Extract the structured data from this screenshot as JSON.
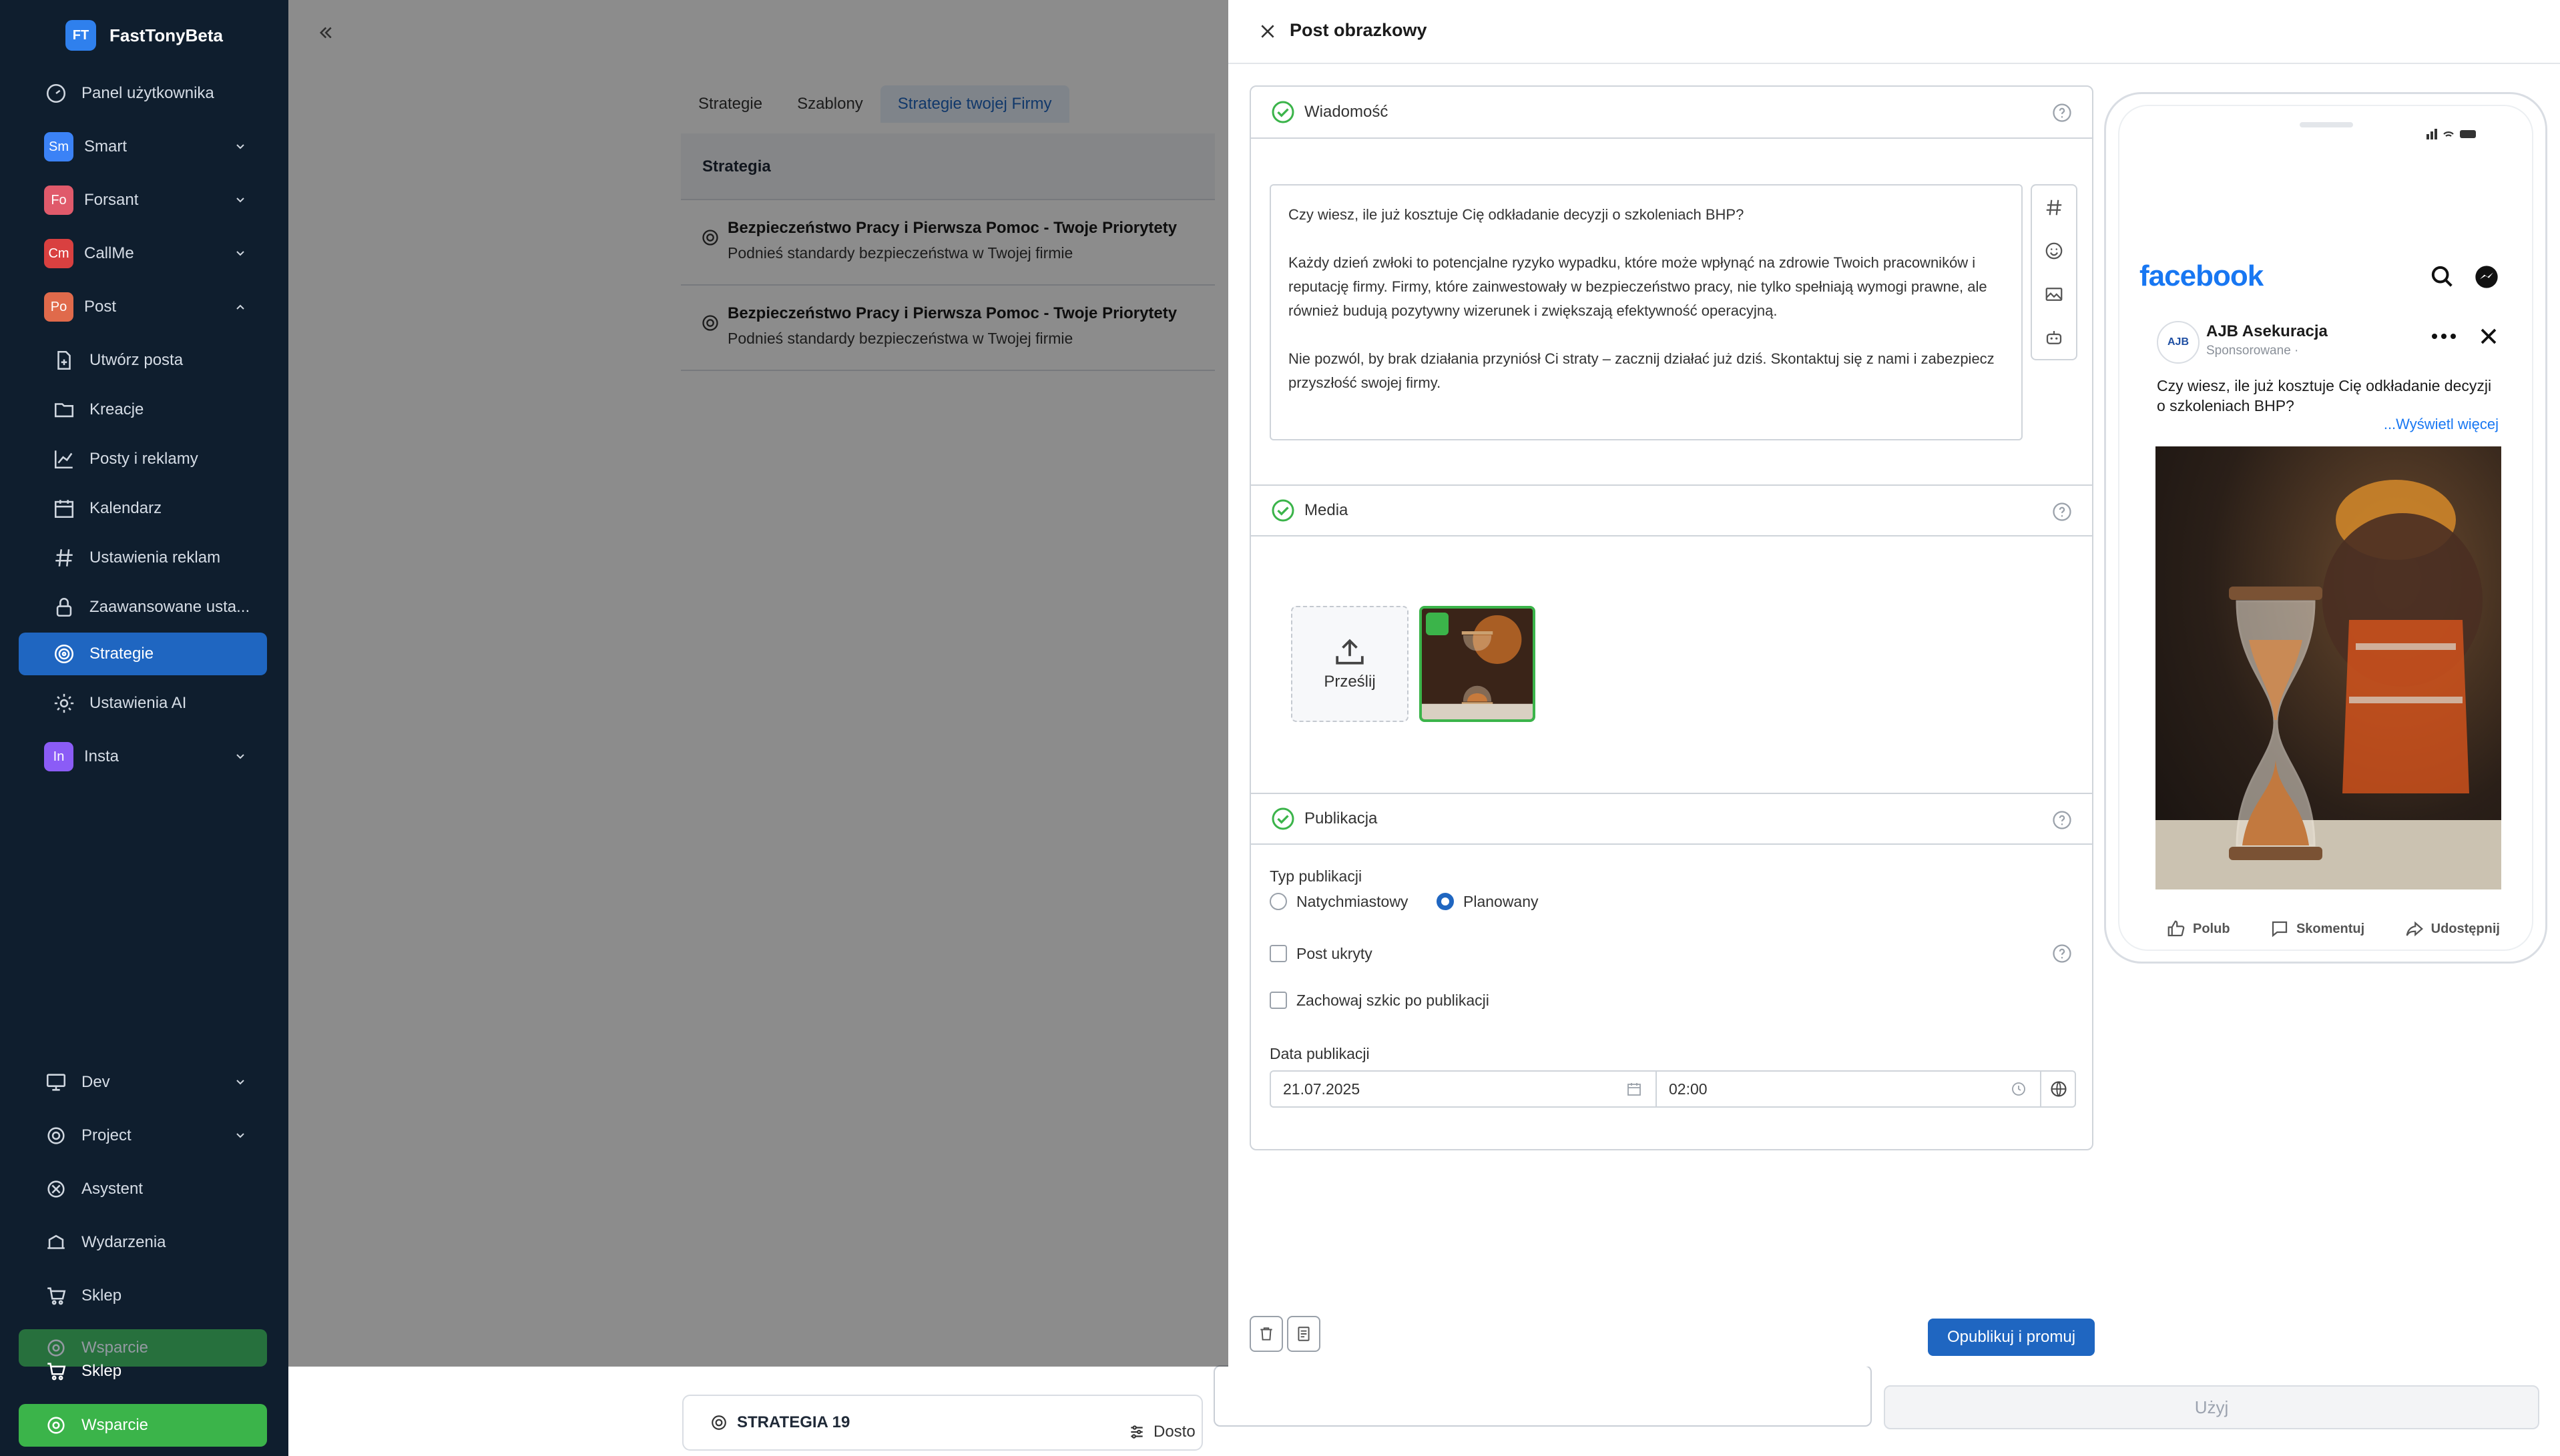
{
  "sidebar": {
    "brand": {
      "logo": "FT",
      "name": "FastTonyBeta"
    },
    "items": [
      {
        "label": "Panel użytkownika",
        "icon": "dashboard-icon"
      },
      {
        "label": "Smart",
        "badge": "Sm",
        "badge_color": "#3b82f6",
        "expandable": true
      },
      {
        "label": "Forsant",
        "badge": "Fo",
        "badge_color": "#e05a6b",
        "expandable": true
      },
      {
        "label": "CallMe",
        "badge": "Cm",
        "badge_color": "#d94040",
        "expandable": true
      },
      {
        "label": "Post",
        "badge": "Po",
        "badge_color": "#e06a4b",
        "expandable": true,
        "expanded": true
      },
      {
        "label": "Utwórz posta",
        "icon": "file-plus-icon",
        "sub": true
      },
      {
        "label": "Kreacje",
        "icon": "folder-icon",
        "sub": true
      },
      {
        "label": "Posty i reklamy",
        "icon": "chart-line-icon",
        "sub": true
      },
      {
        "label": "Kalendarz",
        "icon": "calendar-icon",
        "sub": true
      },
      {
        "label": "Ustawienia reklam",
        "icon": "hash-icon",
        "sub": true
      },
      {
        "label": "Zaawansowane usta...",
        "icon": "lock-icon",
        "sub": true
      },
      {
        "label": "Strategie",
        "icon": "target-icon",
        "sub": true,
        "active": true
      },
      {
        "label": "Ustawienia AI",
        "icon": "gear-icon",
        "sub": true
      },
      {
        "label": "Insta",
        "badge": "In",
        "badge_color": "#8b5cf6",
        "expandable": true
      }
    ],
    "bottom_items": [
      {
        "label": "Dev",
        "icon": "monitor-icon",
        "expandable": true
      },
      {
        "label": "Project",
        "icon": "cog-icon",
        "expandable": true
      },
      {
        "label": "Asystent",
        "icon": "openai-icon"
      },
      {
        "label": "Wydarzenia",
        "icon": "events-icon"
      },
      {
        "label": "Sklep",
        "icon": "cart-icon"
      },
      {
        "label": "Wsparcie",
        "icon": "support-icon"
      }
    ],
    "footer": {
      "shop_label": "Sklep",
      "support_label": "Wsparcie",
      "accent": "#3bb44a"
    }
  },
  "background": {
    "tabs": [
      "Strategie",
      "Szablony",
      "Strategie twojej Firmy"
    ],
    "active_tab": "Strategie twojej Firmy",
    "table_header": "Strategia",
    "rows": [
      {
        "title": "Bezpieczeństwo Pracy i Pierwsza Pomoc - Twoje Priorytety",
        "subtitle": "Podnieś standardy bezpieczeństwa w Twojej firmie"
      },
      {
        "title": "Bezpieczeństwo Pracy i Pierwsza Pomoc - Twoje Priorytety",
        "subtitle": "Podnieś standardy bezpieczeństwa w Twojej firmie"
      }
    ],
    "strategy_card": "STRATEGIA 19",
    "strategy_card_right": "Dosto",
    "use_button": "Użyj"
  },
  "drawer": {
    "title": "Post obrazkowy",
    "sections": {
      "message": "Wiadomość",
      "media": "Media",
      "publication": "Publikacja"
    },
    "message": {
      "p1": "Czy wiesz, ile już kosztuje Cię odkładanie decyzji o szkoleniach BHP?",
      "p2": "Każdy dzień zwłoki to potencjalne ryzyko wypadku, które może wpłynąć na zdrowie Twoich pracowników i reputację firmy. Firmy, które zainwestowały w bezpieczeństwo pracy, nie tylko spełniają wymogi prawne, ale również budują pozytywny wizerunek i zwiększają efektywność operacyjną.",
      "p3": "Nie pozwól, by brak działania przyniósł Ci straty – zacznij działać już dziś. Skontaktuj się z nami i zabezpiecz przyszłość swojej firmy."
    },
    "media": {
      "upload_label": "Prześlij"
    },
    "publication": {
      "type_label": "Typ publikacji",
      "option_immediate": "Natychmiastowy",
      "option_scheduled": "Planowany",
      "selected": "Planowany",
      "hidden_post": "Post ukryty",
      "keep_draft": "Zachowaj szkic po publikacji",
      "date_label": "Data publikacji",
      "date": "21.07.2025",
      "time": "02:00"
    },
    "publish_button": "Opublikuj i promuj"
  },
  "preview": {
    "network": "facebook",
    "page_name": "AJB Asekuracja",
    "sponsored": "Sponsorowane ·",
    "avatar_text": "AJB",
    "text": "Czy wiesz, ile już kosztuje Cię odkładanie decyzji o szkoleniach BHP?",
    "see_more": "...Wyświetl więcej",
    "actions": [
      "Polub",
      "Skomentuj",
      "Udostępnij"
    ],
    "brand_color": "#1877f2"
  }
}
